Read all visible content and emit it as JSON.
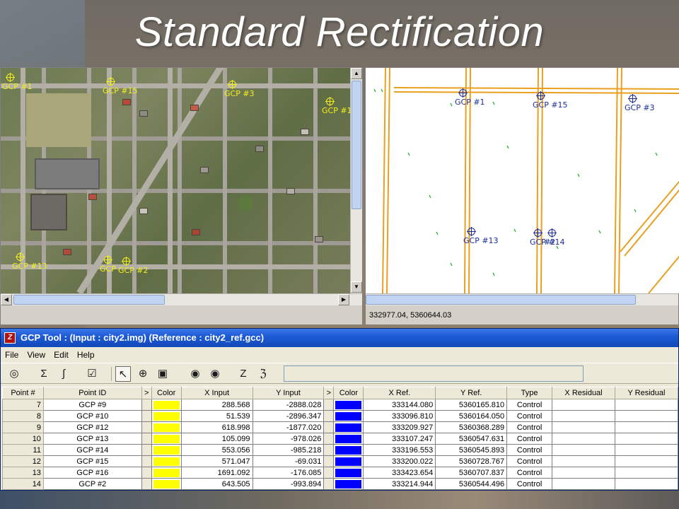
{
  "slide": {
    "title": "Standard Rectification"
  },
  "viewer_left": {
    "markers": [
      {
        "label": "GCP #1"
      },
      {
        "label": "GCP #15"
      },
      {
        "label": "GCP #3"
      },
      {
        "label": "GCP #1"
      },
      {
        "label": "GCP #13"
      },
      {
        "label": "GCP"
      },
      {
        "label": "GCP #2"
      }
    ]
  },
  "viewer_right": {
    "markers": [
      {
        "label": "GCP #1"
      },
      {
        "label": "GCP #15"
      },
      {
        "label": "GCP #3"
      },
      {
        "label": "GCP #13"
      },
      {
        "label": "GCP #14"
      },
      {
        "label": "#2"
      }
    ],
    "status_coords": "332977.04, 5360644.03"
  },
  "colors": {
    "input_swatch": "#ffff00",
    "reference_swatch": "#0000ff",
    "vector_line": "#e8a020",
    "gcp_yellow": "#f2f01a",
    "gcp_blue": "#1a2d9a"
  },
  "gcp_tool": {
    "title": "GCP Tool : (Input : city2.img) (Reference : city2_ref.gcc)",
    "app_icon": "Z",
    "menu": {
      "file": "File",
      "view": "View",
      "edit": "Edit",
      "help": "Help"
    },
    "toolbar_icons": [
      "target-icon",
      "sigma-icon",
      "formula-icon",
      "checklist-icon",
      "arrow-select-icon",
      "crosshair-icon",
      "lock-icon",
      "binoculars-icon",
      "binoculars-next-icon",
      "z-icon",
      "z-outline-icon"
    ],
    "columns": {
      "point_no": "Point #",
      "point_id": "Point ID",
      "sep1": ">",
      "color_input": "Color",
      "x_input": "X Input",
      "y_input": "Y Input",
      "sep2": ">",
      "color_ref": "Color",
      "x_ref": "X Ref.",
      "y_ref": "Y Ref.",
      "type": "Type",
      "x_residual": "X Residual",
      "y_residual": "Y Residual"
    },
    "rows": [
      {
        "num": "7",
        "id": "GCP #9",
        "x_in": "288.568",
        "y_in": "-2888.028",
        "x_ref": "333144.080",
        "y_ref": "5360165.810",
        "type": "Control"
      },
      {
        "num": "8",
        "id": "GCP #10",
        "x_in": "51.539",
        "y_in": "-2896.347",
        "x_ref": "333096.810",
        "y_ref": "5360164.050",
        "type": "Control"
      },
      {
        "num": "9",
        "id": "GCP #12",
        "x_in": "618.998",
        "y_in": "-1877.020",
        "x_ref": "333209.927",
        "y_ref": "5360368.289",
        "type": "Control"
      },
      {
        "num": "10",
        "id": "GCP #13",
        "x_in": "105.099",
        "y_in": "-978.026",
        "x_ref": "333107.247",
        "y_ref": "5360547.631",
        "type": "Control"
      },
      {
        "num": "11",
        "id": "GCP #14",
        "x_in": "553.056",
        "y_in": "-985.218",
        "x_ref": "333196.553",
        "y_ref": "5360545.893",
        "type": "Control"
      },
      {
        "num": "12",
        "id": "GCP #15",
        "x_in": "571.047",
        "y_in": "-69.031",
        "x_ref": "333200.022",
        "y_ref": "5360728.767",
        "type": "Control"
      },
      {
        "num": "13",
        "id": "GCP #16",
        "x_in": "1691.092",
        "y_in": "-176.085",
        "x_ref": "333423.654",
        "y_ref": "5360707.837",
        "type": "Control"
      },
      {
        "num": "14",
        "id": "GCP #2",
        "x_in": "643.505",
        "y_in": "-993.894",
        "x_ref": "333214.944",
        "y_ref": "5360544.496",
        "type": "Control"
      }
    ]
  }
}
